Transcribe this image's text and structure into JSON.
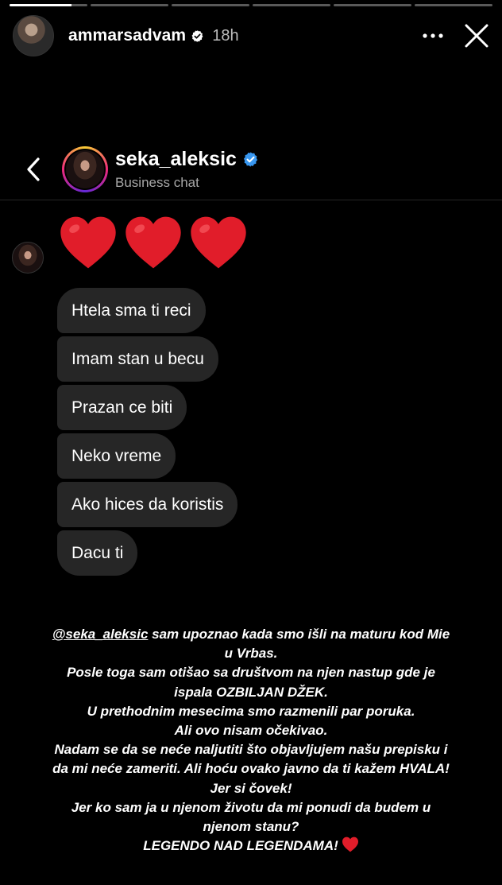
{
  "story": {
    "progress_segments": [
      0.8,
      0,
      0,
      0,
      0,
      0
    ],
    "username": "ammarsadvam",
    "time": "18h",
    "icons": {
      "more": "more-horizontal-icon",
      "close": "close-icon",
      "verified": "verified-badge-icon"
    }
  },
  "chat": {
    "back_icon": "chevron-left-icon",
    "name": "seka_aleksic",
    "subtitle": "Business chat",
    "reaction_hearts": [
      "heart-icon",
      "heart-icon",
      "heart-icon"
    ],
    "messages": [
      "Htela sma ti reci",
      "Imam stan u becu",
      "Prazan ce biti",
      "Neko vreme",
      "Ako hices da koristis",
      "Dacu ti"
    ],
    "colors": {
      "bubble": "#262626",
      "verified": "#3897f0",
      "heart": "#e11d2a"
    }
  },
  "caption": {
    "mention": "@seka_aleksic",
    "line1_rest": " sam upoznao kada smo išli na maturu kod Mie",
    "line2": "u Vrbas.",
    "line3": "Posle toga sam otišao sa društvom na njen nastup gde je",
    "line4": "ispala OZBILJAN DŽEK.",
    "line5": "U prethodnim mesecima smo razmenili par poruka.",
    "line6": "Ali ovo nisam očekivao.",
    "line7": "Nadam se da se neće naljutiti što objavljujem našu prepisku i",
    "line8": "da mi neće zameriti. Ali hoću ovako javno da ti kažem HVALA!",
    "line9": "Jer si čovek!",
    "line10": "Jer ko sam ja u njenom životu da mi ponudi da budem u",
    "line11": "njenom stanu?",
    "line12": "LEGENDO NAD LEGENDAMA!",
    "end_icon": "heart-icon"
  }
}
